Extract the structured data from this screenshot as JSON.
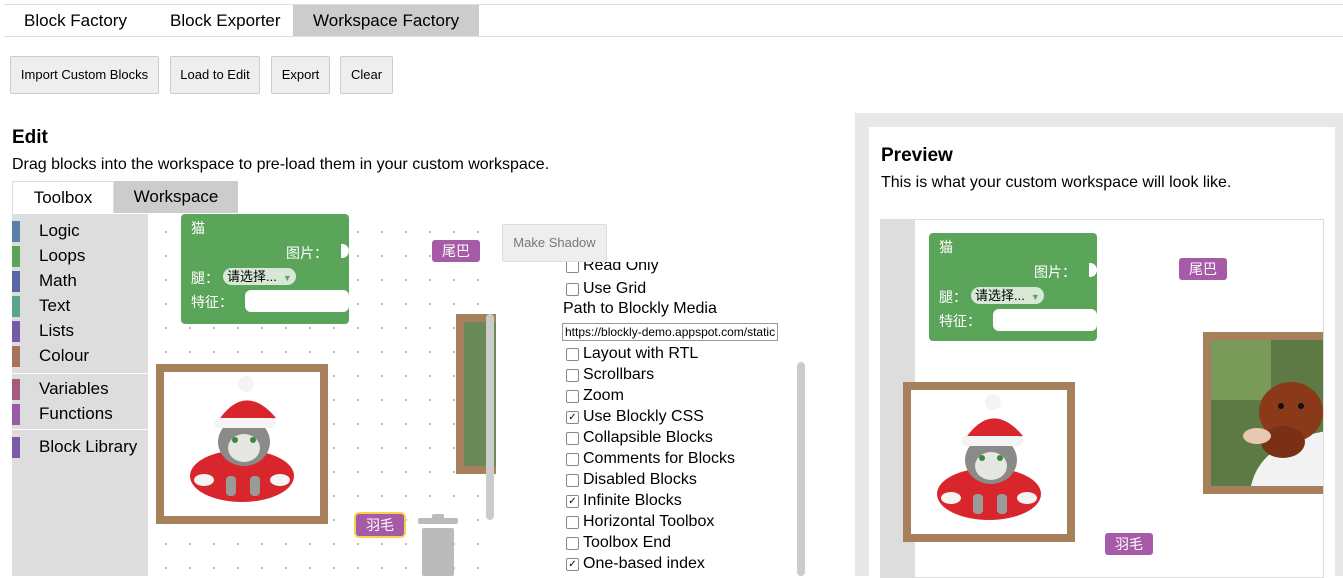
{
  "tabs": [
    {
      "label": "Block Factory",
      "active": false
    },
    {
      "label": "Block Exporter",
      "active": false
    },
    {
      "label": "Workspace Factory",
      "active": true
    }
  ],
  "toolbar": {
    "import_label": "Import Custom Blocks",
    "load_label": "Load to Edit",
    "export_label": "Export",
    "clear_label": "Clear"
  },
  "edit": {
    "title": "Edit",
    "description": "Drag blocks into the workspace to pre-load them in your custom workspace.",
    "subtabs": [
      {
        "label": "Toolbox",
        "active": false
      },
      {
        "label": "Workspace",
        "active": true
      }
    ]
  },
  "categories": [
    {
      "label": "Logic",
      "color": "#5b80a5"
    },
    {
      "label": "Loops",
      "color": "#5ba55b"
    },
    {
      "label": "Math",
      "color": "#5b67a5"
    },
    {
      "label": "Text",
      "color": "#5ba58c"
    },
    {
      "label": "Lists",
      "color": "#745ba5"
    },
    {
      "label": "Colour",
      "color": "#a5745b"
    },
    {
      "label": "Variables",
      "color": "#a55b80"
    },
    {
      "label": "Functions",
      "color": "#995ba5"
    },
    {
      "label": "Block Library",
      "color": "#7b5ba5"
    }
  ],
  "blocks": {
    "cat_block": {
      "title": "猫",
      "image_label": "图片：",
      "leg_label": "腿：",
      "leg_value": "请选择...",
      "feature_label": "特征："
    },
    "tail_label": "尾巴",
    "feather_label": "羽毛"
  },
  "make_shadow_label": "Make Shadow",
  "options": {
    "read_only_label": "Read Only",
    "use_grid_label": "Use Grid",
    "media_path_label": "Path to Blockly Media",
    "media_path_value": "https://blockly-demo.appspot.com/static/media/",
    "items": [
      {
        "label": "Layout with RTL",
        "checked": false
      },
      {
        "label": "Scrollbars",
        "checked": false
      },
      {
        "label": "Zoom",
        "checked": false
      },
      {
        "label": "Use Blockly CSS",
        "checked": true
      },
      {
        "label": "Collapsible Blocks",
        "checked": false
      },
      {
        "label": "Comments for Blocks",
        "checked": false
      },
      {
        "label": "Disabled Blocks",
        "checked": false
      },
      {
        "label": "Infinite Blocks",
        "checked": true
      },
      {
        "label": "Horizontal Toolbox",
        "checked": false
      },
      {
        "label": "Toolbox End",
        "checked": false
      },
      {
        "label": "One-based index",
        "checked": true
      }
    ]
  },
  "preview": {
    "title": "Preview",
    "description": "This is what your custom workspace will look like."
  },
  "colors": {
    "green_block": "#5ba55b",
    "purple_block": "#a55ba5",
    "colour_frame": "#a5805b",
    "tab_active": "#cccccc",
    "sidebar_bg": "#dddddd"
  }
}
